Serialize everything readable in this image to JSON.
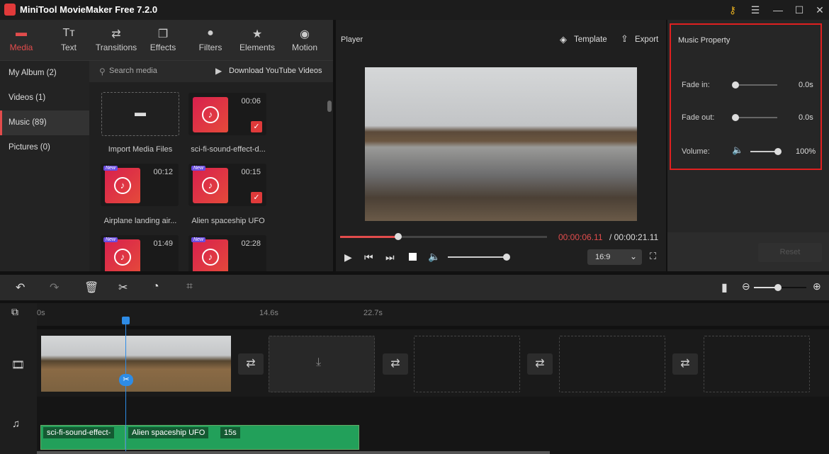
{
  "app": {
    "title": "MiniTool MovieMaker Free 7.2.0"
  },
  "tabs": [
    {
      "label": "Media",
      "icon": "folder-icon"
    },
    {
      "label": "Text",
      "icon": "text-icon"
    },
    {
      "label": "Transitions",
      "icon": "transitions-icon"
    },
    {
      "label": "Effects",
      "icon": "effects-icon"
    },
    {
      "label": "Filters",
      "icon": "filters-icon"
    },
    {
      "label": "Elements",
      "icon": "elements-icon"
    },
    {
      "label": "Motion",
      "icon": "motion-icon"
    }
  ],
  "categories": [
    "My Album (2)",
    "Videos (1)",
    "Music (89)",
    "Pictures (0)"
  ],
  "media": {
    "search_placeholder": "Search media",
    "download": "Download YouTube Videos",
    "import": "Import Media Files",
    "items": [
      {
        "name": "sci-fi-sound-effect-d...",
        "duration": "00:06",
        "new": "",
        "checked": true
      },
      {
        "name": "Airplane landing air...",
        "duration": "00:12",
        "new": "New",
        "checked": false
      },
      {
        "name": "Alien spaceship UFO",
        "duration": "00:15",
        "new": "New",
        "checked": true
      },
      {
        "name": "",
        "duration": "01:49",
        "new": "New",
        "checked": false
      },
      {
        "name": "",
        "duration": "02:28",
        "new": "New",
        "checked": false
      }
    ]
  },
  "player": {
    "title": "Player",
    "template": "Template",
    "export": "Export",
    "current_time": "00:00:06.11",
    "total_time": "/ 00:00:21.11",
    "progress_percent": 28,
    "volume_percent": 100,
    "aspect": "16:9"
  },
  "music_property": {
    "title": "Music Property",
    "fade_in_label": "Fade in:",
    "fade_in": "0.0s",
    "fade_out_label": "Fade out:",
    "fade_out": "0.0s",
    "volume_label": "Volume:",
    "volume": "100%",
    "reset": "Reset"
  },
  "timeline": {
    "ruler": [
      "0s",
      "14.6s",
      "22.7s"
    ],
    "audio_clips": [
      {
        "name": "sci-fi-sound-effect-"
      },
      {
        "name": "Alien spaceship UFO",
        "duration": "15s"
      }
    ]
  },
  "colors": {
    "accent": "#e24c4c",
    "audio": "#22a05a",
    "playhead": "#2e8ce6"
  }
}
